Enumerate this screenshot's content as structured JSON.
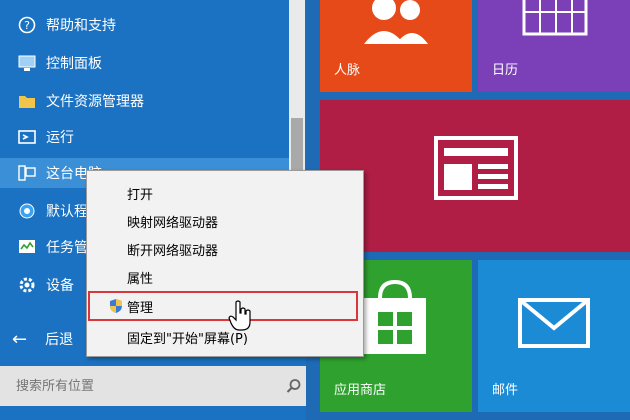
{
  "start_menu": {
    "items": [
      {
        "label": "帮助和支持",
        "icon": "help-icon"
      },
      {
        "label": "控制面板",
        "icon": "control-panel-icon"
      },
      {
        "label": "文件资源管理器",
        "icon": "folder-icon"
      },
      {
        "label": "运行",
        "icon": "run-icon"
      },
      {
        "label": "这台电脑",
        "icon": "computer-icon"
      },
      {
        "label": "默认程序",
        "icon": "default-programs-icon"
      },
      {
        "label": "任务管理器",
        "icon": "task-manager-icon"
      },
      {
        "label": "设备",
        "icon": "gear-icon"
      }
    ],
    "back_label": "后退",
    "search_placeholder": "搜索所有位置"
  },
  "tiles": [
    {
      "label": "人脉",
      "color": "#e64a19"
    },
    {
      "label": "日历",
      "color": "#7b3fb8"
    },
    {
      "label": "资讯",
      "color": "#b01e45"
    },
    {
      "label": "应用商店",
      "color": "#2fa12f"
    },
    {
      "label": "邮件",
      "color": "#1b8bd6"
    }
  ],
  "context_menu": {
    "items": [
      "打开",
      "映射网络驱动器",
      "断开网络驱动器",
      "属性",
      "管理",
      "固定到\"开始\"屏幕(P)"
    ],
    "selected": "管理"
  },
  "colors": {
    "start_blue": "#1b72c2",
    "highlight": "#d9373c"
  }
}
